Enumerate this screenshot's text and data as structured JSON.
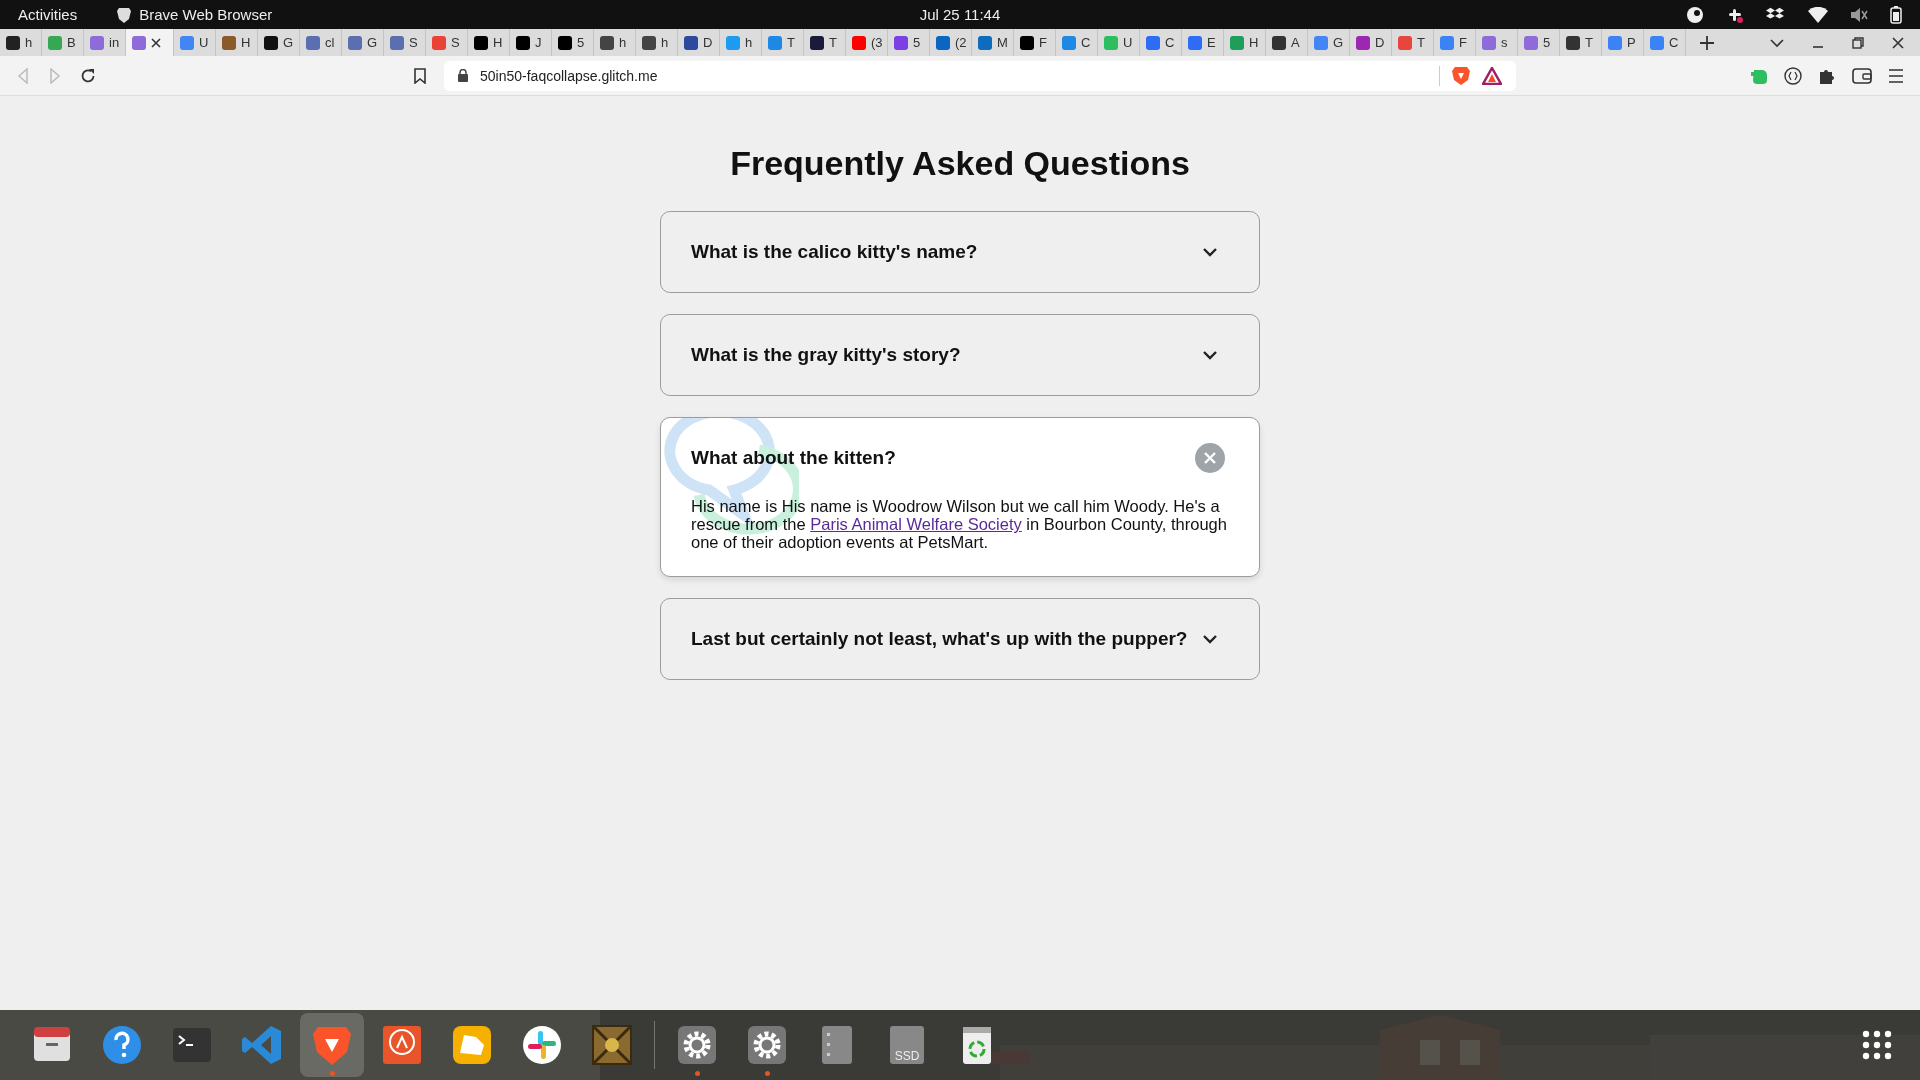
{
  "top_bar": {
    "activities": "Activities",
    "app_name": "Brave Web Browser",
    "clock": "Jul 25  11:44"
  },
  "tabs": [
    {
      "label": "h",
      "selected": false,
      "color": "#222222"
    },
    {
      "label": "B",
      "selected": false,
      "color": "#34a853"
    },
    {
      "label": "in",
      "selected": false,
      "color": "#8e6bd8"
    },
    {
      "selected": true,
      "color": "#8e6bd8"
    },
    {
      "label": "U",
      "selected": false,
      "color": "#4285f4"
    },
    {
      "label": "H",
      "selected": false,
      "color": "#8a5a2b"
    },
    {
      "label": "G",
      "selected": false,
      "color": "#111111"
    },
    {
      "label": "cl",
      "selected": false,
      "color": "#5b6fb0"
    },
    {
      "label": "G",
      "selected": false,
      "color": "#5b6fb0"
    },
    {
      "label": "S",
      "selected": false,
      "color": "#5b6fb0"
    },
    {
      "label": "S",
      "selected": false,
      "color": "#ea4335"
    },
    {
      "label": "H",
      "selected": false,
      "color": "#000000"
    },
    {
      "label": "J",
      "selected": false,
      "color": "#000000"
    },
    {
      "label": "5",
      "selected": false,
      "color": "#000000"
    },
    {
      "label": "h",
      "selected": false,
      "color": "#444444"
    },
    {
      "label": "h",
      "selected": false,
      "color": "#444444"
    },
    {
      "label": "D",
      "selected": false,
      "color": "#2b4a9e"
    },
    {
      "label": "h",
      "selected": false,
      "color": "#1d9bf0"
    },
    {
      "label": "T",
      "selected": false,
      "color": "#1e88e5"
    },
    {
      "label": "T",
      "selected": false,
      "color": "#1a1a3a"
    },
    {
      "label": "(3",
      "selected": false,
      "color": "#ff0000"
    },
    {
      "label": "5",
      "selected": false,
      "color": "#7b3fe4"
    },
    {
      "label": "(2",
      "selected": false,
      "color": "#0a66c2"
    },
    {
      "label": "M",
      "selected": false,
      "color": "#0f6cbd"
    },
    {
      "label": "F",
      "selected": false,
      "color": "#000000"
    },
    {
      "label": "C",
      "selected": false,
      "color": "#1e88e5"
    },
    {
      "label": "U",
      "selected": false,
      "color": "#2dbe60"
    },
    {
      "label": "C",
      "selected": false,
      "color": "#2e6cf6"
    },
    {
      "label": "E",
      "selected": false,
      "color": "#2e6cf6"
    },
    {
      "label": "H",
      "selected": false,
      "color": "#1e9e5a"
    },
    {
      "label": "A",
      "selected": false,
      "color": "#333333"
    },
    {
      "label": "G",
      "selected": false,
      "color": "#4285f4"
    },
    {
      "label": "D",
      "selected": false,
      "color": "#9c27b0"
    },
    {
      "label": "T",
      "selected": false,
      "color": "#e8453c"
    },
    {
      "label": "F",
      "selected": false,
      "color": "#3b82f6"
    },
    {
      "label": "s",
      "selected": false,
      "color": "#8e6bd8"
    },
    {
      "label": "5",
      "selected": false,
      "color": "#8e6bd8"
    },
    {
      "label": "T",
      "selected": false,
      "color": "#333333"
    },
    {
      "label": "P",
      "selected": false,
      "color": "#3b82f6"
    },
    {
      "label": "C",
      "selected": false,
      "color": "#3b82f6"
    }
  ],
  "nav": {
    "back_disabled": true,
    "forward_disabled": true
  },
  "address_bar": {
    "url": "50in50-faqcollapse.glitch.me"
  },
  "page": {
    "title": "Frequently Asked Questions",
    "faqs": [
      {
        "question": "What is the calico kitty's name?",
        "expanded": false
      },
      {
        "question": "What is the gray kitty's story?",
        "expanded": false
      },
      {
        "question": "What about the kitten?",
        "expanded": true,
        "answer_before": "His name is His name is Woodrow Wilson but we call him Woody. He's a rescue from the ",
        "link": "Paris Animal Welfare Society",
        "answer_after": " in Bourbon County, through one of their adoption events at PetsMart."
      },
      {
        "question": "Last but certainly not least, what's up with the pupper?",
        "expanded": false
      }
    ]
  },
  "dock": {
    "apps": [
      {
        "kind": "files",
        "running": false,
        "selected": false
      },
      {
        "kind": "help",
        "running": false,
        "selected": false
      },
      {
        "kind": "terminal",
        "running": false,
        "selected": false
      },
      {
        "kind": "code",
        "running": false,
        "selected": false
      },
      {
        "kind": "brave",
        "running": true,
        "selected": true
      },
      {
        "kind": "appstore",
        "running": false,
        "selected": false
      },
      {
        "kind": "rhino",
        "running": false,
        "selected": false
      },
      {
        "kind": "slack",
        "running": false,
        "selected": false
      },
      {
        "kind": "dosbox",
        "running": false,
        "selected": false
      },
      {
        "kind": "settings",
        "running": true,
        "selected": false
      },
      {
        "kind": "settings",
        "running": true,
        "selected": false
      },
      {
        "kind": "drive",
        "running": false,
        "selected": false
      },
      {
        "kind": "ssd",
        "running": false,
        "selected": false,
        "label": "SSD"
      },
      {
        "kind": "trash",
        "running": false,
        "selected": false
      }
    ]
  }
}
